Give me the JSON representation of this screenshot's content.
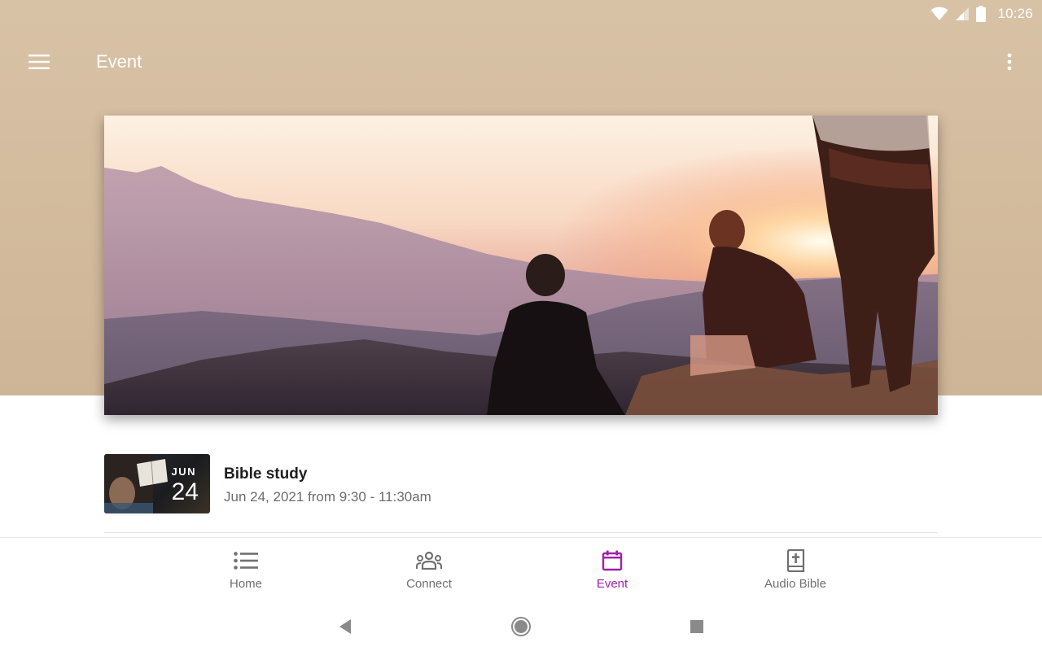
{
  "status_bar": {
    "time": "10:26"
  },
  "app_bar": {
    "title": "Event"
  },
  "hero": {
    "icon": "hero-sunset-image"
  },
  "events": [
    {
      "title": "Bible study",
      "datetime": "Jun 24, 2021 from 9:30 - 11:30am",
      "thumb_month": "JUN",
      "thumb_day": "24"
    }
  ],
  "bottom_nav": {
    "items": [
      {
        "label": "Home",
        "icon": "list-icon"
      },
      {
        "label": "Connect",
        "icon": "group-icon"
      },
      {
        "label": "Event",
        "icon": "calendar-icon"
      },
      {
        "label": "Audio Bible",
        "icon": "bible-icon"
      }
    ],
    "active": "Event"
  },
  "colors": {
    "accent": "#a020a8",
    "header_bg": "#d4bc9f",
    "nav_inactive": "#707070"
  }
}
